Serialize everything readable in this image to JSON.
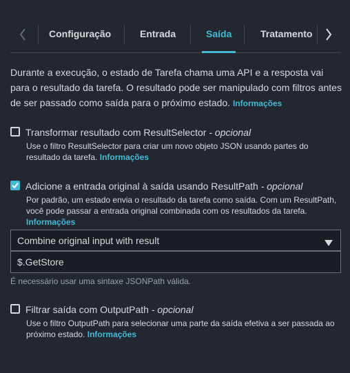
{
  "tabs": [
    {
      "label": "Configuração",
      "active": false
    },
    {
      "label": "Entrada",
      "active": false
    },
    {
      "label": "Saída",
      "active": true
    },
    {
      "label": "Tratamento",
      "active": false
    }
  ],
  "intro": {
    "text": "Durante a execução, o estado de Tarefa chama uma API e a resposta vai para o resultado da tarefa. O resultado pode ser manipulado com filtros antes de ser passado como saída para o próximo estado.",
    "link": "Informações"
  },
  "result_selector": {
    "checked": false,
    "label": "Transformar resultado com ResultSelector",
    "optional": "- opcional",
    "desc": "Use o filtro ResultSelector para criar um novo objeto JSON usando partes do resultado da tarefa.",
    "link": "Informações"
  },
  "result_path": {
    "checked": true,
    "label": "Adicione a entrada original à saída usando ResultPath",
    "optional": "- opcional",
    "desc": "Por padrão, um estado envia o resultado da tarefa como saída. Com um ResultPath, você pode passar a entrada original combinada com os resultados da tarefa.",
    "link": "Informações",
    "select_value": "Combine original input with result",
    "input_value": "$.GetStore",
    "hint": "É necessário usar uma sintaxe JSONPath válida."
  },
  "output_path": {
    "checked": false,
    "label": "Filtrar saída com OutputPath",
    "optional": "- opcional",
    "desc": "Use o filtro OutputPath para selecionar uma parte da saída efetiva a ser passada ao próximo estado.",
    "link": "Informações"
  },
  "colors": {
    "background": "#232730",
    "accent": "#44b9d6",
    "text": "#d5dbdb",
    "muted": "#95a5a6"
  }
}
